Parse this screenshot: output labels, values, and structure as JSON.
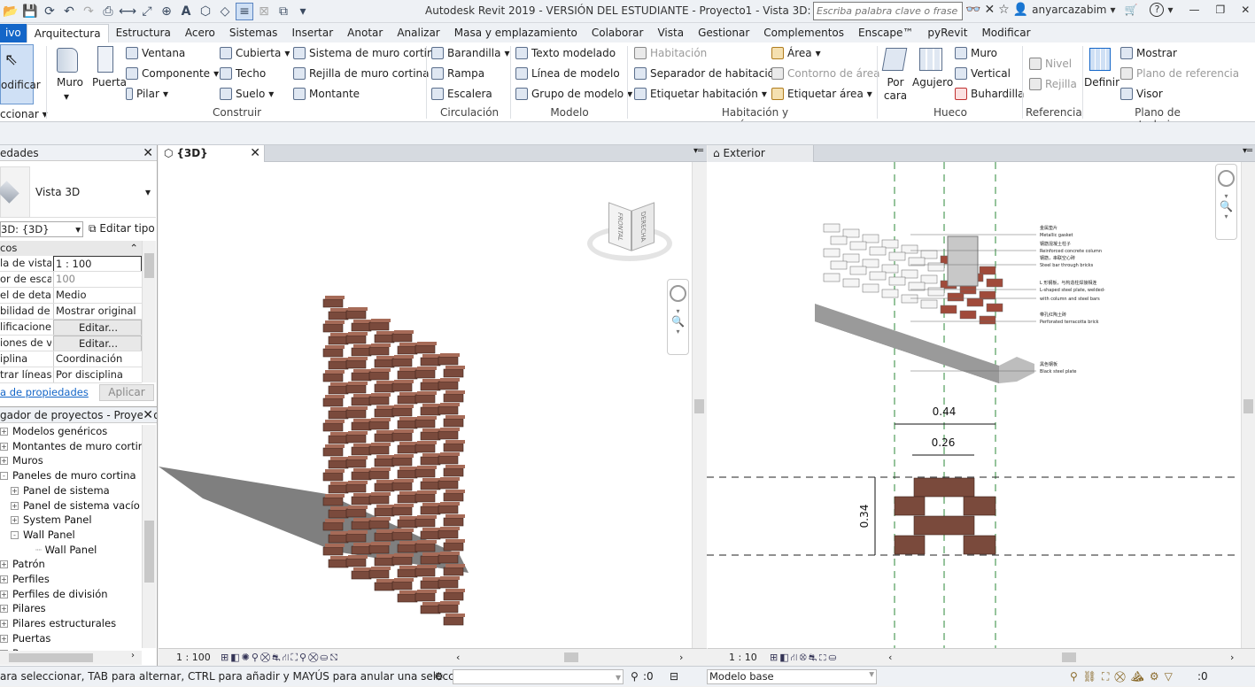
{
  "app": {
    "title": "Autodesk Revit 2019 - VERSIÓN DEL ESTUDIANTE - Proyecto1 - Vista 3D: {3D}",
    "search_placeholder": "Escriba palabra clave o frase",
    "user": "anyarcazabim",
    "help_icon": "?"
  },
  "ribbon_tabs": [
    "ivo",
    "Arquitectura",
    "Estructura",
    "Acero",
    "Sistemas",
    "Insertar",
    "Anotar",
    "Analizar",
    "Masa y emplazamiento",
    "Colaborar",
    "Vista",
    "Gestionar",
    "Complementos",
    "Enscape™",
    "pyRevit",
    "Modificar"
  ],
  "ribbon": {
    "modificar": "odificar",
    "seleccionar": "ccionar",
    "muro": "Muro",
    "puerta": "Puerta",
    "ventana": "Ventana",
    "componente": "Componente",
    "pilar": "Pilar",
    "cubierta": "Cubierta",
    "techo": "Techo",
    "suelo": "Suelo",
    "sistema_muro_cortina": "Sistema de muro cortina",
    "rejilla_muro_cortina": "Rejilla de muro cortina",
    "montante": "Montante",
    "construir": "Construir",
    "barandilla": "Barandilla",
    "rampa": "Rampa",
    "escalera": "Escalera",
    "circulacion": "Circulación",
    "texto_modelado": "Texto modelado",
    "linea_modelo": "Línea de modelo",
    "grupo_modelo": "Grupo de modelo",
    "modelo": "Modelo",
    "habitacion": "Habitación",
    "separador_habitacion": "Separador  de habitación",
    "etiquetar_habitacion": "Etiquetar  habitación",
    "area": "Área",
    "contorno_area": "Contorno  de área",
    "etiquetar_area": "Etiquetar  área",
    "habitacion_area": "Habitación y área",
    "por_cara": "Por cara",
    "agujero": "Agujero",
    "muro2": "Muro",
    "vertical": "Vertical",
    "buhardilla": "Buhardilla",
    "hueco": "Hueco",
    "nivel": "Nivel",
    "rejilla": "Rejilla",
    "referencia": "Referencia",
    "definir": "Definir",
    "mostrar": "Mostrar",
    "plano_referencia": "Plano de referencia",
    "visor": "Visor",
    "plano_trabajo": "Plano de trabajo"
  },
  "properties": {
    "title": "edades",
    "type_name": "Vista 3D",
    "instance": "3D: {3D}",
    "edit_type": "Editar tipo",
    "section": "cos",
    "rows": [
      {
        "k": "la de vista",
        "v": "1 : 100"
      },
      {
        "k": "or de escal...",
        "v": "100"
      },
      {
        "k": "el de detalle",
        "v": "Medio"
      },
      {
        "k": "bilidad de ...",
        "v": "Mostrar original"
      },
      {
        "k": "lificacione...",
        "v": "Editar..."
      },
      {
        "k": "iones de v...",
        "v": "Editar..."
      },
      {
        "k": "iplina",
        "v": "Coordinación"
      },
      {
        "k": "trar líneas...",
        "v": "Por disciplina"
      }
    ],
    "help_link": "a de propiedades",
    "apply": "Aplicar"
  },
  "browser": {
    "title": "gador de proyectos - Proyecto1",
    "items": [
      {
        "label": "Modelos genéricos",
        "level": 0,
        "sign": "+"
      },
      {
        "label": "Montantes de muro cortina",
        "level": 0,
        "sign": "+"
      },
      {
        "label": "Muros",
        "level": 0,
        "sign": "+"
      },
      {
        "label": "Paneles de muro cortina",
        "level": 0,
        "sign": "-"
      },
      {
        "label": "Panel de sistema",
        "level": 1,
        "sign": "+"
      },
      {
        "label": "Panel de sistema vacío",
        "level": 1,
        "sign": "+"
      },
      {
        "label": "System Panel",
        "level": 1,
        "sign": "+"
      },
      {
        "label": "Wall Panel",
        "level": 1,
        "sign": "-"
      },
      {
        "label": "Wall Panel",
        "level": 2,
        "sign": ""
      },
      {
        "label": "Patrón",
        "level": 0,
        "sign": "+"
      },
      {
        "label": "Perfiles",
        "level": 0,
        "sign": "+"
      },
      {
        "label": "Perfiles de división",
        "level": 0,
        "sign": "+"
      },
      {
        "label": "Pilares",
        "level": 0,
        "sign": "+"
      },
      {
        "label": "Pilares estructurales",
        "level": 0,
        "sign": "+"
      },
      {
        "label": "Puertas",
        "level": 0,
        "sign": "+"
      },
      {
        "label": "Rampas",
        "level": 0,
        "sign": "+"
      }
    ]
  },
  "view3d": {
    "tab": "{3D}",
    "scale": "1 : 100",
    "cube_left": "FRONTAL",
    "cube_right": "DERECHA"
  },
  "exterior": {
    "tab": "Exterior",
    "scale": "1 : 10",
    "dim_044": "0.44",
    "dim_026": "0.26",
    "dim_034": "0.34",
    "annotations": [
      {
        "cn": "金属垫片",
        "en": "Metallic gasket"
      },
      {
        "cn": "钢筋混凝土柱子",
        "en": "Reinforced concrete column"
      },
      {
        "cn": "钢筋，串联空心砖",
        "en": "Steel bar through bricks"
      },
      {
        "cn": "L 形钢板，与构造柱焊接相连",
        "en": "L-shaped steel plate,  welded-"
      },
      {
        "cn": "",
        "en": "with column and steel bars"
      },
      {
        "cn": "带孔红陶土砖",
        "en": "Perforated terracotta brick"
      },
      {
        "cn": "黑色钢板",
        "en": "Black steel plate"
      }
    ]
  },
  "status": {
    "hint": "ara seleccionar, TAB para alternar, CTRL para añadir y MAYÚS para anular una selección.",
    "zero1": ":0",
    "model": "Modelo base",
    "zero2": ":0"
  },
  "colors": {
    "brick": "#7a4a3c",
    "brick_light": "#a66b58",
    "accent": "#1466c8",
    "dash": "#2d8a3a"
  }
}
